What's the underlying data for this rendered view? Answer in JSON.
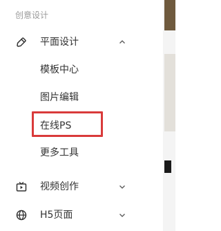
{
  "sidebar": {
    "section_title": "创意设计",
    "items": [
      {
        "label": "平面设计",
        "icon": "pen-tool-icon",
        "expanded": true,
        "children": [
          {
            "label": "模板中心"
          },
          {
            "label": "图片编辑"
          },
          {
            "label": "在线PS",
            "highlighted": true
          },
          {
            "label": "更多工具"
          }
        ]
      },
      {
        "label": "视频创作",
        "icon": "video-tv-icon",
        "expanded": false
      },
      {
        "label": "H5页面",
        "icon": "globe-icon",
        "expanded": false
      }
    ]
  },
  "colors": {
    "highlight_border": "#d93a3a",
    "section_title": "#9a9a9a",
    "text": "#333333"
  }
}
